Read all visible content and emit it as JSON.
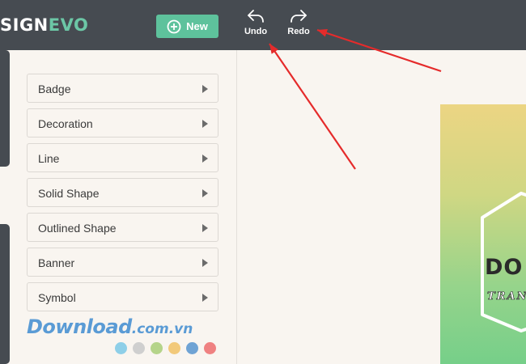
{
  "header": {
    "logo_part1": "SIGN",
    "logo_part2": "EVO",
    "new_label": "New",
    "undo_label": "Undo",
    "redo_label": "Redo"
  },
  "sidebar": {
    "items": [
      {
        "label": "Badge"
      },
      {
        "label": "Decoration"
      },
      {
        "label": "Line"
      },
      {
        "label": "Solid Shape"
      },
      {
        "label": "Outlined Shape"
      },
      {
        "label": "Banner"
      },
      {
        "label": "Symbol"
      }
    ],
    "color_swatches": [
      "#8ecfe8",
      "#cfcfcf",
      "#b5d48a",
      "#f2c97a",
      "#6fa3d4",
      "#ef8181"
    ]
  },
  "watermark": {
    "part1": "Download",
    "part2": ".com.vn"
  },
  "canvas": {
    "badge_text": "DO",
    "badge_subtext": "TRAN"
  },
  "annotations": {
    "arrow_color": "#e52b2b"
  },
  "colors": {
    "topbar": "#464b51",
    "accent": "#5ec29c",
    "background": "#f9f5f0"
  }
}
